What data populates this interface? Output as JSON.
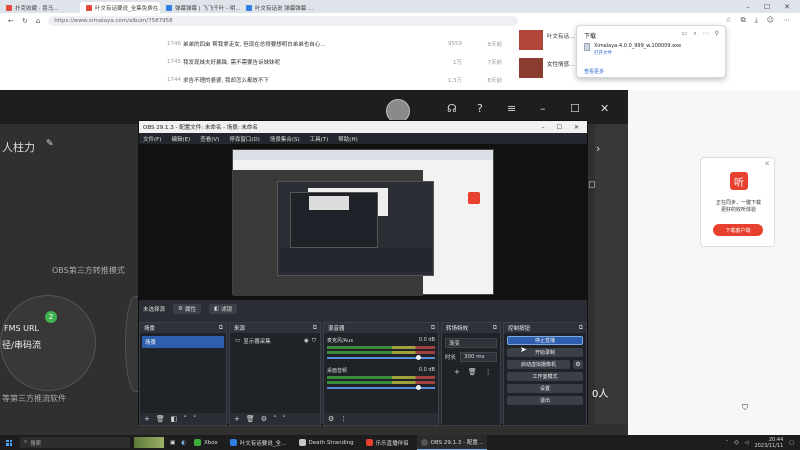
{
  "browser": {
    "tabs": [
      {
        "label": "扑克收藏 · 喜马…",
        "active": false
      },
      {
        "label": "叶文有话要说_全集免费在…",
        "active": true
      },
      {
        "label": "弹幕弹幕 | 飞飞千叶 - 明…",
        "active": false
      },
      {
        "label": "叶文有话说 弹幕弹幕 ...",
        "active": false
      }
    ],
    "url": "https://www.ximalaya.com/album/7587958",
    "list": [
      {
        "no": "1746",
        "title": "弟弟的四亩 帮我拿走女, 但现在总得要想明白弟弟也自心…",
        "plays": "9559",
        "duration": "8天前"
      },
      {
        "no": "1745",
        "title": "我发现妹夫好暴躁, 需不需要告诉妹妹呢",
        "plays": "1万",
        "duration": "7天前"
      },
      {
        "no": "1744",
        "title": "求告不理的婆婆, 我却怎么都放不下",
        "plays": "1.3万",
        "duration": "8天前"
      }
    ],
    "side_items": [
      "叶文有话…",
      "女性情感…"
    ],
    "download": {
      "title": "下载",
      "file_name": "Ximalaya-4.0.0_999_w.100009.exe",
      "open_label": "打开文件",
      "more_label": "查看更多"
    }
  },
  "bg_app": {
    "left_title": "人柱力",
    "obs_label": "OBS第三方转推模式",
    "fms_label": "FMS URL",
    "fms_badge": "2",
    "key_label": "径/串码流",
    "third_party_label": "等第三方推流软件",
    "count_label": "0人",
    "ad": {
      "logo": "听",
      "text": "正在同步，一键下载\n更好的收听体验",
      "button": "下载客户端"
    }
  },
  "obs": {
    "title": "OBS 29.1.3 - 配置文件: 未命名 - 场景: 未命名",
    "menu": [
      "文件(F)",
      "编辑(E)",
      "查看(V)",
      "停靠窗口(D)",
      "场景集合(S)",
      "工具(T)",
      "帮助(H)"
    ],
    "source_bar": {
      "label": "未选择源",
      "props": "属性",
      "filters": "滤镜"
    },
    "docks": {
      "scenes": {
        "title": "场景",
        "items": [
          "场景"
        ]
      },
      "sources": {
        "title": "来源",
        "items": [
          "显示器采集"
        ]
      },
      "mixer": {
        "title": "混音器",
        "channels": [
          {
            "name": "麦克风/Aux",
            "db": "0.0 dB"
          },
          {
            "name": "桌面音频",
            "db": "0.0 dB"
          }
        ]
      },
      "transitions": {
        "title": "转场特效",
        "type": "渐变",
        "duration_label": "时长",
        "duration": "300 ms"
      },
      "controls": {
        "title": "控制按钮",
        "buttons": [
          "停止直播",
          "开始录制",
          "启动虚拟摄像机",
          "工作室模式",
          "设置",
          "退出"
        ]
      }
    }
  },
  "taskbar": {
    "search_placeholder": "搜索",
    "apps": [
      {
        "label": "Xbox",
        "color": "#3fae3f",
        "active": false
      },
      {
        "label": "叶文有话要说_全…",
        "color": "#2d7fe0",
        "active": false
      },
      {
        "label": "Death Stranding",
        "color": "#c7c7c7",
        "active": false
      },
      {
        "label": "乐乐直播伴侣",
        "color": "#e8402e",
        "active": false
      },
      {
        "label": "OBS 29.1.3 - 配置…",
        "color": "#555555",
        "active": true
      }
    ],
    "time": "20:44",
    "date": "2023/11/11"
  }
}
